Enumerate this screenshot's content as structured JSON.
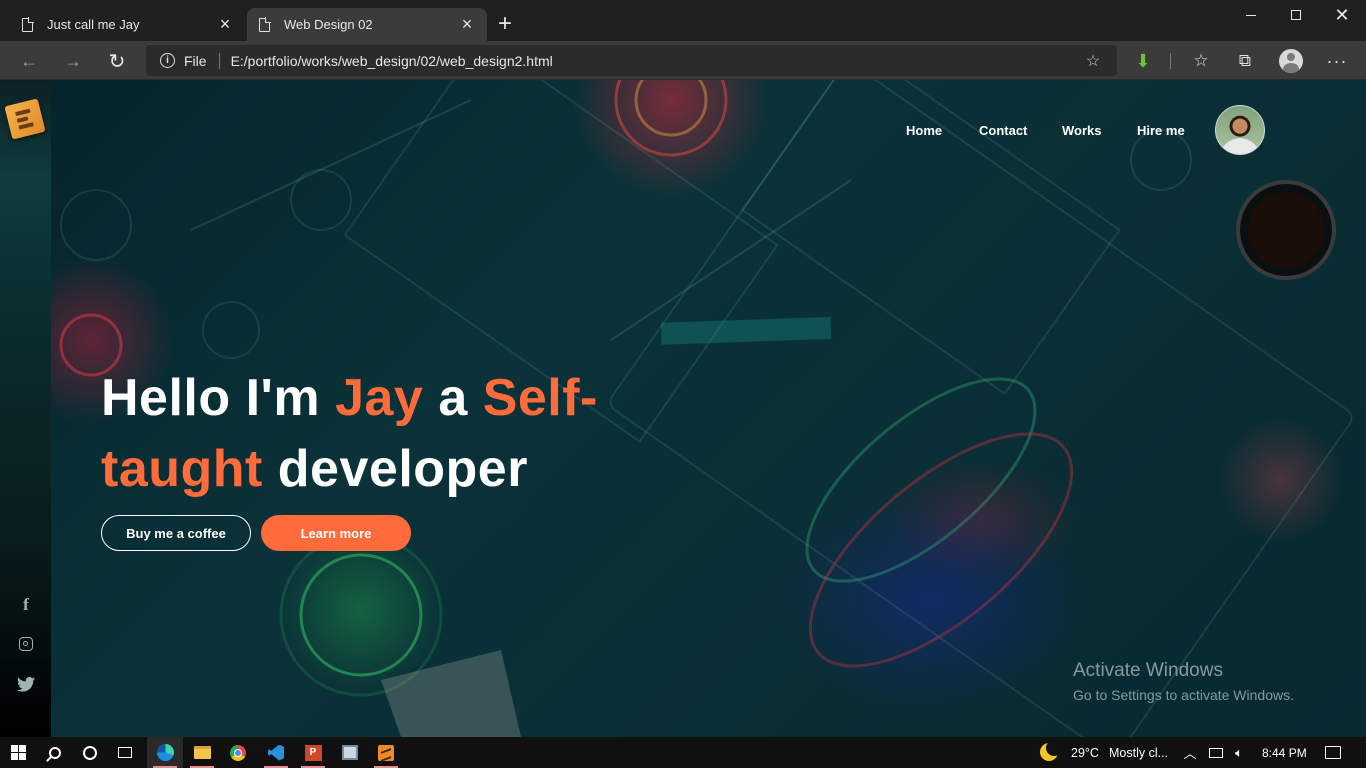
{
  "browser": {
    "tabs": [
      {
        "title": "Just call me Jay",
        "active": false
      },
      {
        "title": "Web Design 02",
        "active": true
      }
    ],
    "address": {
      "scheme": "File",
      "url": "E:/portfolio/works/web_design/02/web_design2.html"
    },
    "window_controls": {
      "minimize": "—",
      "close": "✕"
    },
    "icons": [
      "back-icon",
      "forward-icon",
      "reload-icon",
      "info-icon",
      "add-favorite-icon",
      "extension-download-icon",
      "favorites-icon",
      "collections-icon",
      "profile-icon",
      "more-icon"
    ]
  },
  "page": {
    "nav": {
      "home": "Home",
      "contact": "Contact",
      "works": "Works",
      "hire": "Hire me"
    },
    "hero": {
      "hello": "Hello I'm",
      "name": "Jay",
      "a": "a",
      "self_taught_1": "Self-",
      "self_taught_2": "taught",
      "developer": "developer"
    },
    "buttons": {
      "coffee": "Buy me a coffee",
      "learn": "Learn more"
    },
    "social": {
      "facebook": "f"
    },
    "colors": {
      "accent": "#ff6b3a",
      "background": "#0a3238"
    }
  },
  "watermark": {
    "title": "Activate Windows",
    "subtitle": "Go to Settings to activate Windows."
  },
  "taskbar": {
    "apps": [
      "start-icon",
      "search-icon",
      "cortana-icon",
      "task-view-icon",
      "edge-icon",
      "file-explorer-icon",
      "chrome-icon",
      "vscode-icon",
      "powerpoint-icon",
      "app-icon",
      "sublime-text-icon"
    ],
    "ppt_letter": "P",
    "temperature": "29°C",
    "weather": "Mostly cl...",
    "time": "8:44 PM"
  }
}
